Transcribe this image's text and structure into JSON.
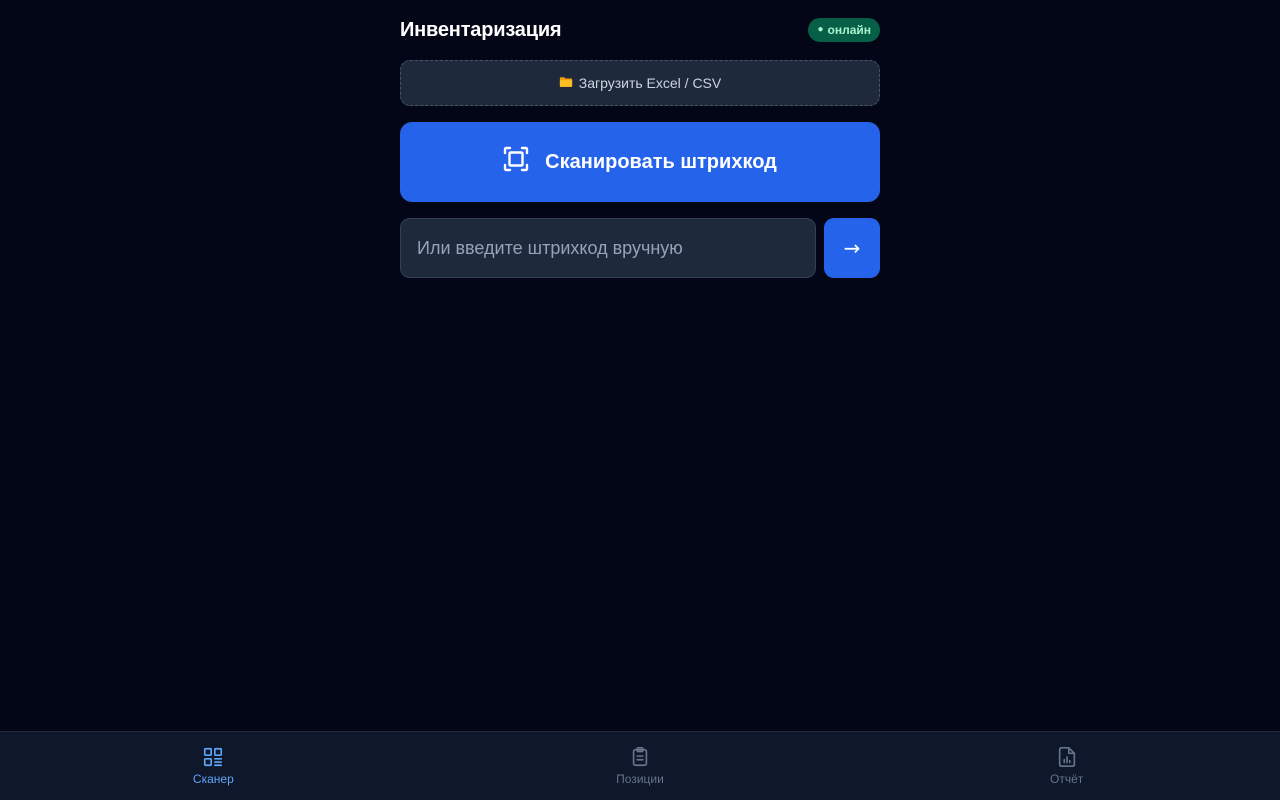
{
  "header": {
    "title": "Инвентаризация",
    "status": "онлайн",
    "status_dot": "●"
  },
  "upload": {
    "icon": "folder-icon",
    "label": "Загрузить Excel / CSV"
  },
  "scan": {
    "icon": "scan-frame-icon",
    "label": "Сканировать штрихкод"
  },
  "manual": {
    "value": "",
    "placeholder": "Или введите штрихкод вручную",
    "submit_label": "→"
  },
  "nav": {
    "items": [
      {
        "label": "Сканер",
        "icon": "scanner-icon",
        "active": true
      },
      {
        "label": "Позиции",
        "icon": "clipboard-icon",
        "active": false
      },
      {
        "label": "Отчёт",
        "icon": "report-icon",
        "active": false
      }
    ]
  },
  "colors": {
    "background": "#020617",
    "accent": "#2563eb",
    "active_nav": "#60a5fa",
    "online_badge": "#065f46"
  }
}
